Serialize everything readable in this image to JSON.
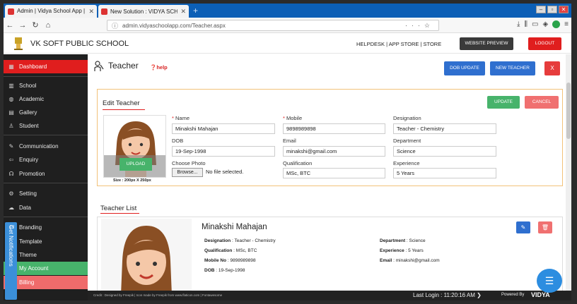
{
  "browser": {
    "tabs": [
      {
        "label": "Admin | Vidya School App | ই",
        "close": "✕"
      },
      {
        "label": "New Solution : VIDYA SCHOOL",
        "close": "✕"
      }
    ],
    "new_tab": "+",
    "url": "admin.vidyaschoolapp.com/Teacher.aspx"
  },
  "header": {
    "school_name": "VK SOFT PUBLIC SCHOOL",
    "links": "HELPDESK | APP STORE | STORE",
    "website_preview": "WEBSITE PREVIEW",
    "logout": "LOGOUT"
  },
  "sidebar": {
    "items": [
      {
        "label": "Dashboard",
        "icon": "▦"
      },
      {
        "label": "School",
        "icon": "▥"
      },
      {
        "label": "Academic",
        "icon": "◍"
      },
      {
        "label": "Gallery",
        "icon": "▤"
      },
      {
        "label": "Student",
        "icon": "♙"
      },
      {
        "label": "Communication",
        "icon": "✎"
      },
      {
        "label": "Enquiry",
        "icon": "⇦"
      },
      {
        "label": "Promotion",
        "icon": "☊"
      },
      {
        "label": "Setting",
        "icon": "⚙"
      },
      {
        "label": "Data",
        "icon": "☁"
      },
      {
        "label": "Branding",
        "icon": ""
      },
      {
        "label": "Template",
        "icon": ""
      },
      {
        "label": "Theme",
        "icon": ""
      },
      {
        "label": "My Account",
        "icon": ""
      },
      {
        "label": "Billing",
        "icon": ""
      }
    ],
    "notifications": "Get Notifications"
  },
  "page": {
    "title": "Teacher",
    "help": "❓help",
    "dob_update": "DOB UPDATE",
    "new_teacher": "NEW TEACHER",
    "close": "X"
  },
  "edit": {
    "title": "Edit Teacher",
    "update": "UPDATE",
    "cancel": "CANCEL",
    "upload": "UPLOAD",
    "photo_size": "Size : 200px X 250px",
    "name_label": "Name",
    "name_value": "Minakshi Mahajan",
    "mobile_label": "Mobile",
    "mobile_value": "9898989898",
    "designation_label": "Designation",
    "designation_value": "Teacher - Chemistry",
    "dob_label": "DOB",
    "dob_value": "19-Sep-1998",
    "email_label": "Email",
    "email_value": "minakshi@gmail.com",
    "department_label": "Department",
    "department_value": "Science",
    "photo_label": "Choose Photo",
    "browse": "Browse...",
    "no_file": "No file selected.",
    "qualification_label": "Qualification",
    "qualification_value": "MSc, BTC",
    "experience_label": "Experience",
    "experience_value": "5 Years"
  },
  "list": {
    "title": "Teacher List",
    "name": "Minakshi Mahajan",
    "designation_k": "Designation",
    "designation_v": " : Teacher - Chemistry",
    "department_k": "Department",
    "department_v": " : Science",
    "qualification_k": "Qualification",
    "qualification_v": " : MSc, BTC",
    "experience_k": "Experience",
    "experience_v": " : 5 Years",
    "mobile_k": "Mobile No",
    "mobile_v": " : 9898989898",
    "email_k": "Email",
    "email_v": " : minakshi@gmail.com",
    "dob_k": "DOB",
    "dob_v": " : 19-Sep-1998"
  },
  "footer": {
    "credit": "Credit : Designed by Freepik | Icon made by Freepik from www.flaticon.com | Fontawesome",
    "last_login": "Last Login : 11:20:16 AM ❯",
    "powered": "Powered By",
    "brand": "VIDYA"
  },
  "colors": {
    "accent_red": "#e01e1e",
    "blue": "#2f6fcf",
    "green": "#47b36b",
    "pink": "#f07070"
  }
}
